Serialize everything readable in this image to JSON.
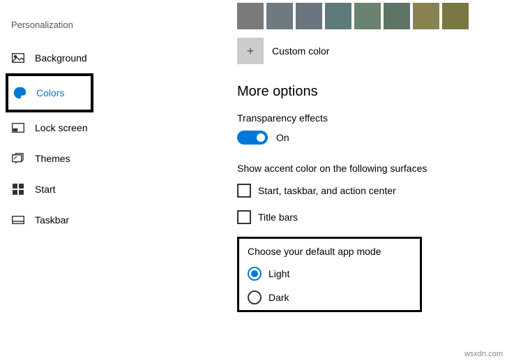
{
  "sidebar": {
    "title": "Personalization",
    "items": [
      {
        "label": "Background"
      },
      {
        "label": "Colors"
      },
      {
        "label": "Lock screen"
      },
      {
        "label": "Themes"
      },
      {
        "label": "Start"
      },
      {
        "label": "Taskbar"
      }
    ]
  },
  "colors": {
    "row_top": [
      "#888888",
      "#787878",
      "#686868",
      "#585858",
      "#484848",
      "#383838",
      "#5b7a2a",
      "#4f6b22"
    ],
    "row": [
      "#7a7a7a",
      "#6e7a7f",
      "#6a7580",
      "#5e7a7a",
      "#6a8270",
      "#5e7465",
      "#8a8250",
      "#7a7840"
    ],
    "custom_label": "Custom color"
  },
  "more_options": {
    "title": "More options",
    "transparency_label": "Transparency effects",
    "transparency_state": "On",
    "accent_label": "Show accent color on the following surfaces",
    "checkbox1": "Start, taskbar, and action center",
    "checkbox2": "Title bars",
    "app_mode_label": "Choose your default app mode",
    "radio_light": "Light",
    "radio_dark": "Dark"
  },
  "watermark": "wsxdn.com"
}
